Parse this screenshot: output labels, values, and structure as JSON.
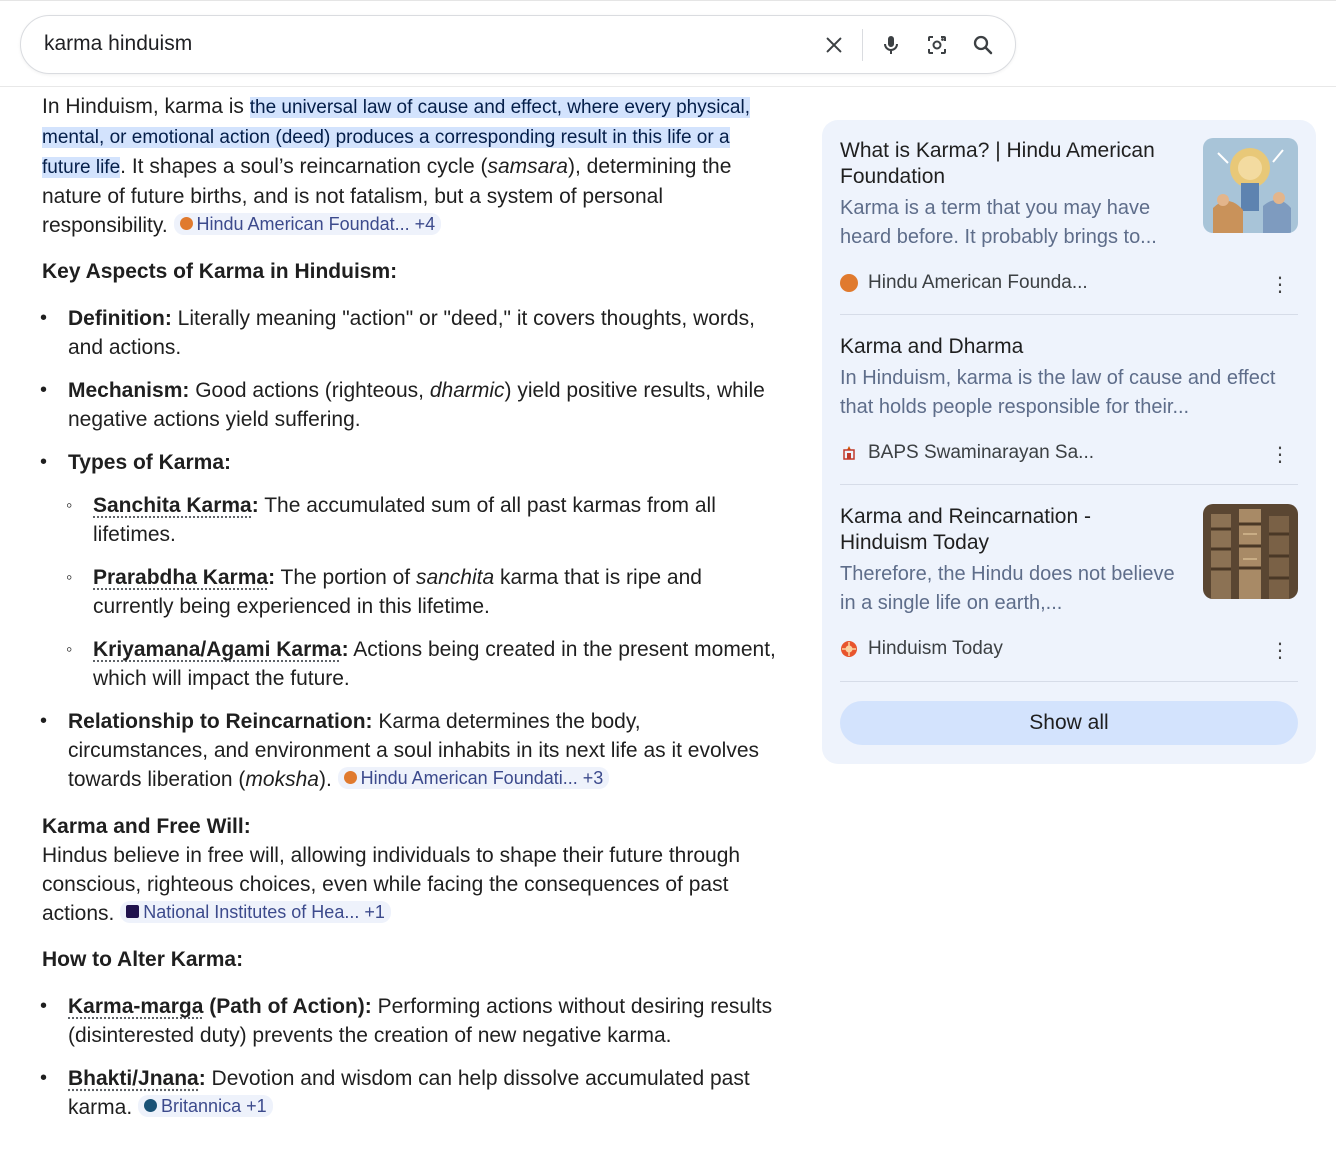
{
  "search": {
    "query": "karma hinduism"
  },
  "answer": {
    "intro_pre": "In Hinduism, karma is ",
    "intro_highlight": "the universal law of cause and effect, where every physical, mental, or emotional action (deed) produces a corresponding result in this life or a future life",
    "intro_post_a": ". It shapes a soul’s reincarnation cycle (",
    "intro_italic": "samsara",
    "intro_post_b": "), determining the nature of future births, and is not fatalism, but a system of personal responsibility.",
    "intro_chip": "Hindu American Foundat... +4",
    "key_title": "Key Aspects of Karma in Hinduism:",
    "definition_label": "Definition:",
    "definition_text": " Literally meaning \"action\" or \"deed,\" it covers thoughts, words, and actions.",
    "mechanism_label": "Mechanism:",
    "mechanism_text_a": " Good actions (righteous, ",
    "mechanism_italic": "dharmic",
    "mechanism_text_b": ") yield positive results, while negative actions yield suffering.",
    "types_label": "Types of Karma:",
    "sanchita_label": "Sanchita Karma",
    "sanchita_text": " The accumulated sum of all past karmas from all lifetimes.",
    "prarabdha_label": "Prarabdha Karma",
    "prarabdha_text_a": " The portion of ",
    "prarabdha_italic": "sanchita",
    "prarabdha_text_b": " karma that is ripe and currently being experienced in this lifetime.",
    "kriyamana_label": "Kriyamana/Agami Karma",
    "kriyamana_text": " Actions being created in the present moment, which will impact the future.",
    "relationship_label": "Relationship to Reincarnation:",
    "relationship_text_a": " Karma determines the body, circumstances, and environment a soul inhabits in its next life as it evolves towards liberation (",
    "relationship_italic": "moksha",
    "relationship_text_b": ").",
    "relationship_chip": "Hindu American Foundati... +3",
    "freewill_title": "Karma and Free Will:",
    "freewill_text": "Hindus believe in free will, allowing individuals to shape their future through conscious, righteous choices, even while facing the consequences of past actions.",
    "freewill_chip": "National Institutes of Hea... +1",
    "alter_title": "How to Alter Karma:",
    "karmamarga_label": "Karma-marga",
    "karmamarga_label_b": " (Path of Action):",
    "karmamarga_text": " Performing actions without desiring results (disinterested duty) prevents the creation of new negative karma.",
    "bhakti_label": "Bhakti/Jnana",
    "bhakti_text": " Devotion and wisdom can help dissolve accumulated past karma.",
    "bhakti_chip": "Britannica +1",
    "colon": ":"
  },
  "sources": {
    "cards": [
      {
        "title": "What is Karma? | Hindu American Foundation",
        "snippet": "Karma is a term that you may have heard before. It probably brings to...",
        "source": "Hindu American Founda...",
        "favicon_color": "#e07a2e"
      },
      {
        "title": "Karma and Dharma",
        "snippet": "In Hinduism, karma is the law of cause and effect that holds people responsible for their...",
        "source": "BAPS Swaminarayan Sa...",
        "favicon_color": "#c0392b"
      },
      {
        "title": "Karma and Reincarnation - Hinduism Today",
        "snippet": "Therefore, the Hindu does not believe in a single life on earth,...",
        "source": "Hinduism Today",
        "favicon_color": "#e8552d"
      }
    ],
    "show_all": "Show all"
  }
}
